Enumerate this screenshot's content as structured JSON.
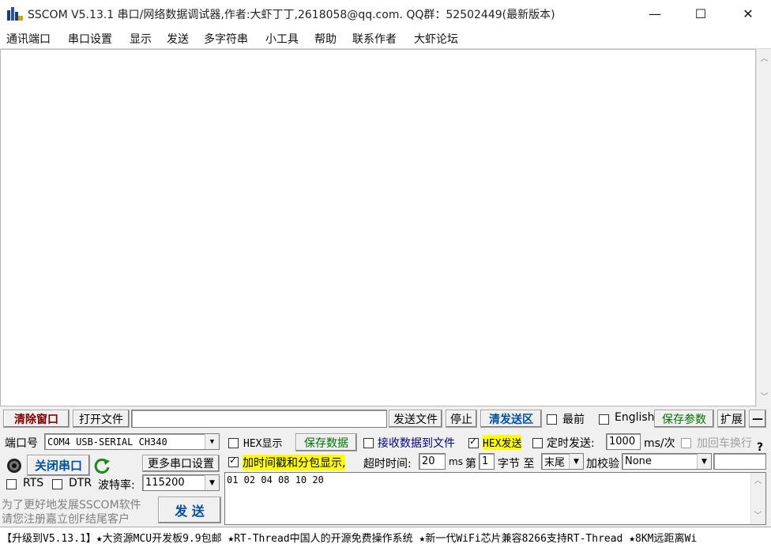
{
  "window": {
    "title": "SSCOM V5.13.1 串口/网络数据调试器,作者:大虾丁丁,2618058@qq.com. QQ群：52502449(最新版本)",
    "minimize": "—",
    "maximize": "☐",
    "close": "✕"
  },
  "menu": [
    "通讯端口",
    "串口设置",
    "显示",
    "发送",
    "多字符串",
    "小工具",
    "帮助",
    "联系作者",
    "大虾论坛"
  ],
  "toolbar": {
    "clear_window": "清除窗口",
    "open_file": "打开文件",
    "file_path": "",
    "send_file": "发送文件",
    "stop": "停止",
    "clear_send": "清发送区",
    "topmost": "最前",
    "english": "English",
    "save_params": "保存参数",
    "expand": "扩展",
    "collapse": "—"
  },
  "port": {
    "label": "端口号",
    "value": "COM4 USB-SERIAL CH340",
    "close_port": "关闭串口",
    "more_settings": "更多串口设置",
    "rts": "RTS",
    "dtr": "DTR",
    "baud_label": "波特率:",
    "baud_value": "115200"
  },
  "options": {
    "hex_display": "HEX显示",
    "save_data": "保存数据",
    "recv_to_file": "接收数据到文件",
    "hex_send": "HEX发送",
    "timed_send": "定时发送:",
    "interval": "1000",
    "interval_unit": "ms/次",
    "add_crlf": "加回车换行",
    "timestamp": "加时间戳和分包显示,",
    "timeout_label": "超时时间:",
    "timeout_value": "20",
    "timeout_unit": "ms",
    "nth_label": "第",
    "nth_value": "1",
    "byte_label": "字节 至",
    "end_value": "末尾",
    "checksum_label": "加校验",
    "checksum_value": "None"
  },
  "send": {
    "content": "01 02 04 08 10 20",
    "button": "发  送"
  },
  "promo": {
    "line1": "为了更好地发展SSCOM软件",
    "line2": "请您注册嘉立创F结尾客户"
  },
  "ticker": "【升级到V5.13.1】★大资源MCU开发板9.9包邮 ★RT-Thread中国人的开源免费操作系统 ★新一代WiFi芯片兼容8266支持RT-Thread ★8KM远距离Wi"
}
